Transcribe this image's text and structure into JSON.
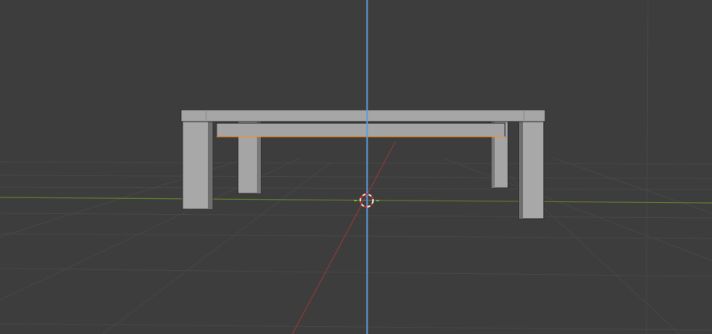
{
  "viewport": {
    "background_color": "#3d3d3d",
    "grid_color": "#4a4a4a",
    "x_axis_color": "#8a3a3a",
    "y_axis_color": "#5e7a2e",
    "z_axis_color": "#5b9ae0",
    "selection_outline_color": "#f0902a",
    "mesh_color": "#a3a3a3",
    "cursor_icon": "3d-cursor-icon"
  }
}
